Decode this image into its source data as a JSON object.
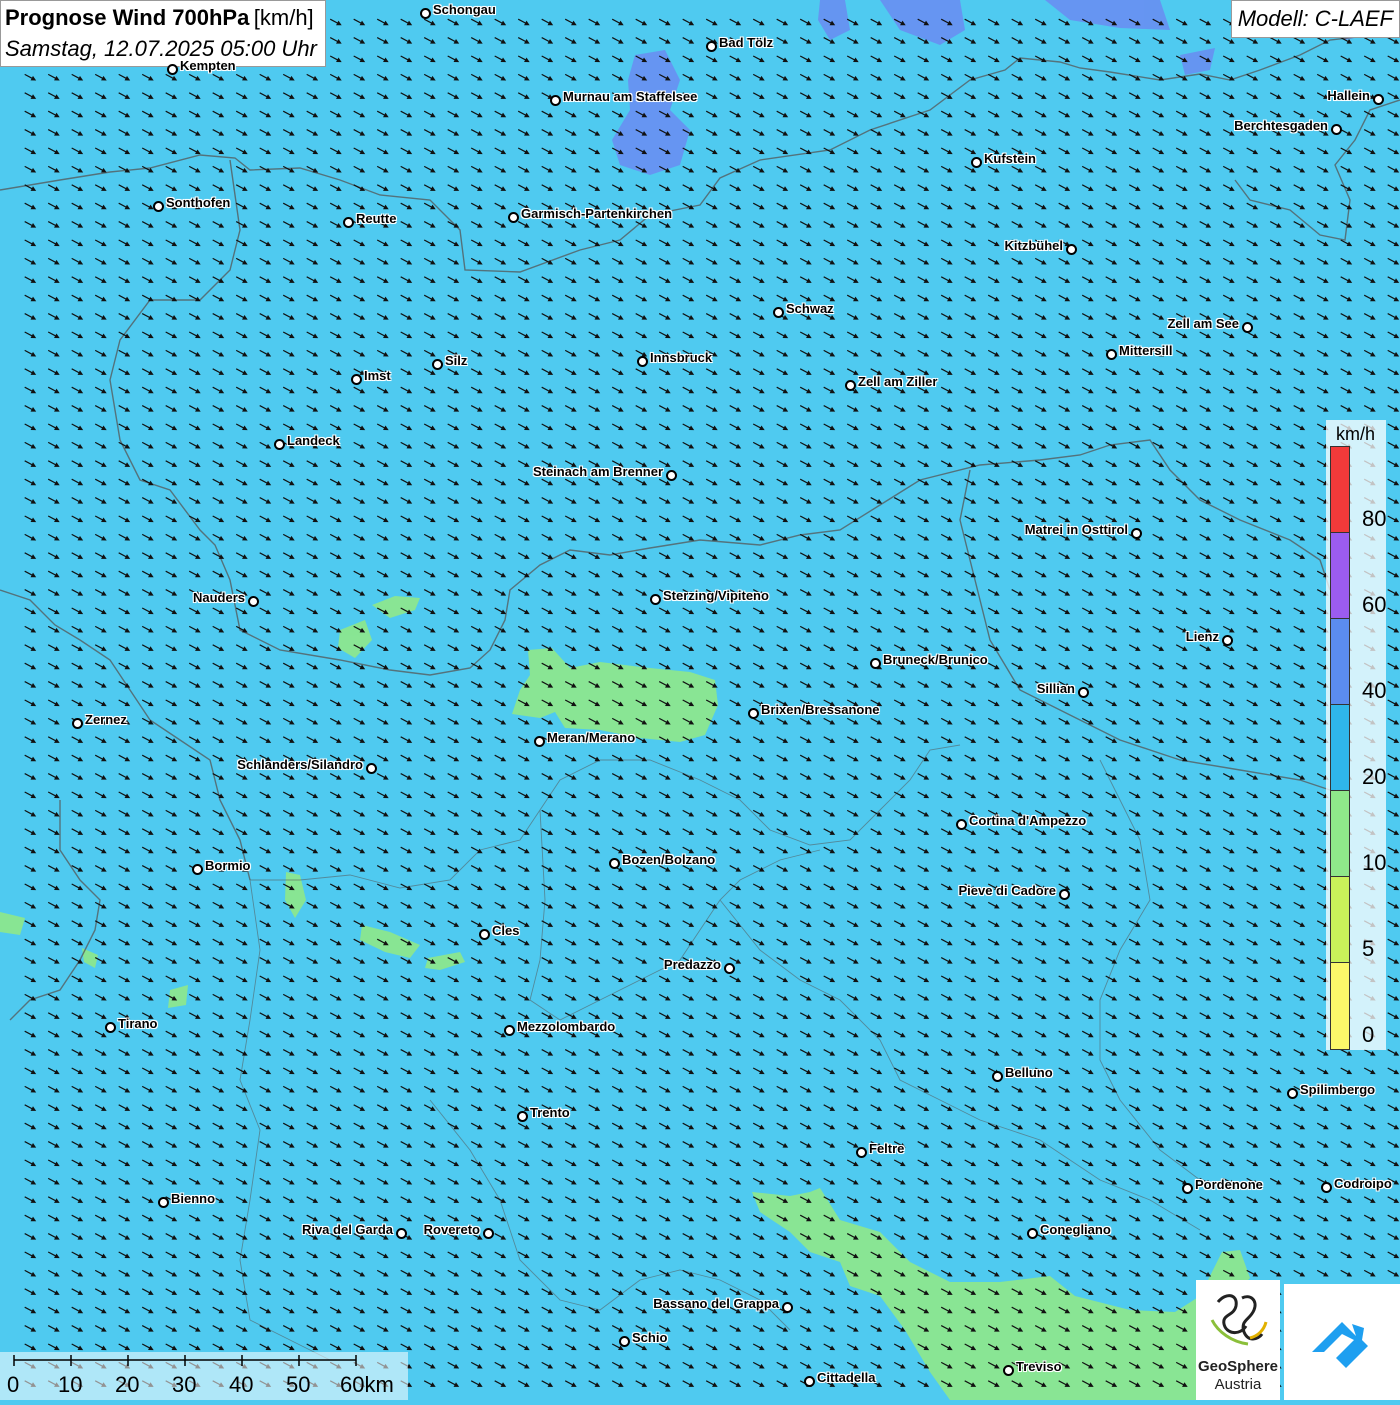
{
  "header": {
    "title": "Prognose Wind 700hPa",
    "unit": "[km/h]",
    "datetime": "Samstag, 12.07.2025 05:00 Uhr",
    "model": "Modell: C-LAEF"
  },
  "colors": {
    "background": "#4fcaf0",
    "calm_area": "#8fe88a",
    "strong_area": "#5b8cf0"
  },
  "legend": {
    "unit": "km/h",
    "labels": [
      "80",
      "60",
      "40",
      "20",
      "10",
      "5",
      "0"
    ],
    "colors": [
      "#f23a3a",
      "#9b5cf0",
      "#5b8cf0",
      "#2fb6ea",
      "#8fe88a",
      "#c9f25a",
      "#fcf86a"
    ]
  },
  "scale": {
    "labels": [
      "0",
      "10",
      "20",
      "30",
      "40",
      "50",
      "60km"
    ]
  },
  "logos": {
    "geosphere_line1": "GeoSphere",
    "geosphere_line2": "Austria"
  },
  "cities": [
    {
      "name": "Schongau"
    },
    {
      "name": "Bad Tölz"
    },
    {
      "name": "Kempten"
    },
    {
      "name": "Murnau am Staffelsee"
    },
    {
      "name": "Hallein"
    },
    {
      "name": "Berchtesgaden"
    },
    {
      "name": "Kufstein"
    },
    {
      "name": "Sonthofen"
    },
    {
      "name": "Reutte"
    },
    {
      "name": "Garmisch-Partenkirchen"
    },
    {
      "name": "Kitzbühel"
    },
    {
      "name": "Schwaz"
    },
    {
      "name": "Zell am See"
    },
    {
      "name": "Mittersill"
    },
    {
      "name": "Silz"
    },
    {
      "name": "Innsbruck"
    },
    {
      "name": "Imst"
    },
    {
      "name": "Zell am Ziller"
    },
    {
      "name": "Landeck"
    },
    {
      "name": "Steinach am Brenner"
    },
    {
      "name": "Matrei in Osttirol"
    },
    {
      "name": "Nauders"
    },
    {
      "name": "Sterzing/Vipiteno"
    },
    {
      "name": "Lienz"
    },
    {
      "name": "Bruneck/Brunico"
    },
    {
      "name": "Sillian"
    },
    {
      "name": "Brixen/Bressanone"
    },
    {
      "name": "Zernez"
    },
    {
      "name": "Meran/Merano"
    },
    {
      "name": "Schlanders/Silandro"
    },
    {
      "name": "Cortina d'Ampezzo"
    },
    {
      "name": "Bozen/Bolzano"
    },
    {
      "name": "Bormio"
    },
    {
      "name": "Pieve di Cadore"
    },
    {
      "name": "Cles"
    },
    {
      "name": "Predazzo"
    },
    {
      "name": "Tirano"
    },
    {
      "name": "Mezzolombardo"
    },
    {
      "name": "Belluno"
    },
    {
      "name": "Spilimbergo"
    },
    {
      "name": "Trento"
    },
    {
      "name": "Feltre"
    },
    {
      "name": "Pordenone"
    },
    {
      "name": "Codroipo"
    },
    {
      "name": "Bienno"
    },
    {
      "name": "Riva del Garda"
    },
    {
      "name": "Rovereto"
    },
    {
      "name": "Conegliano"
    },
    {
      "name": "Bassano del Grappa"
    },
    {
      "name": "Schio"
    },
    {
      "name": "Treviso"
    },
    {
      "name": "Cittadella"
    }
  ]
}
